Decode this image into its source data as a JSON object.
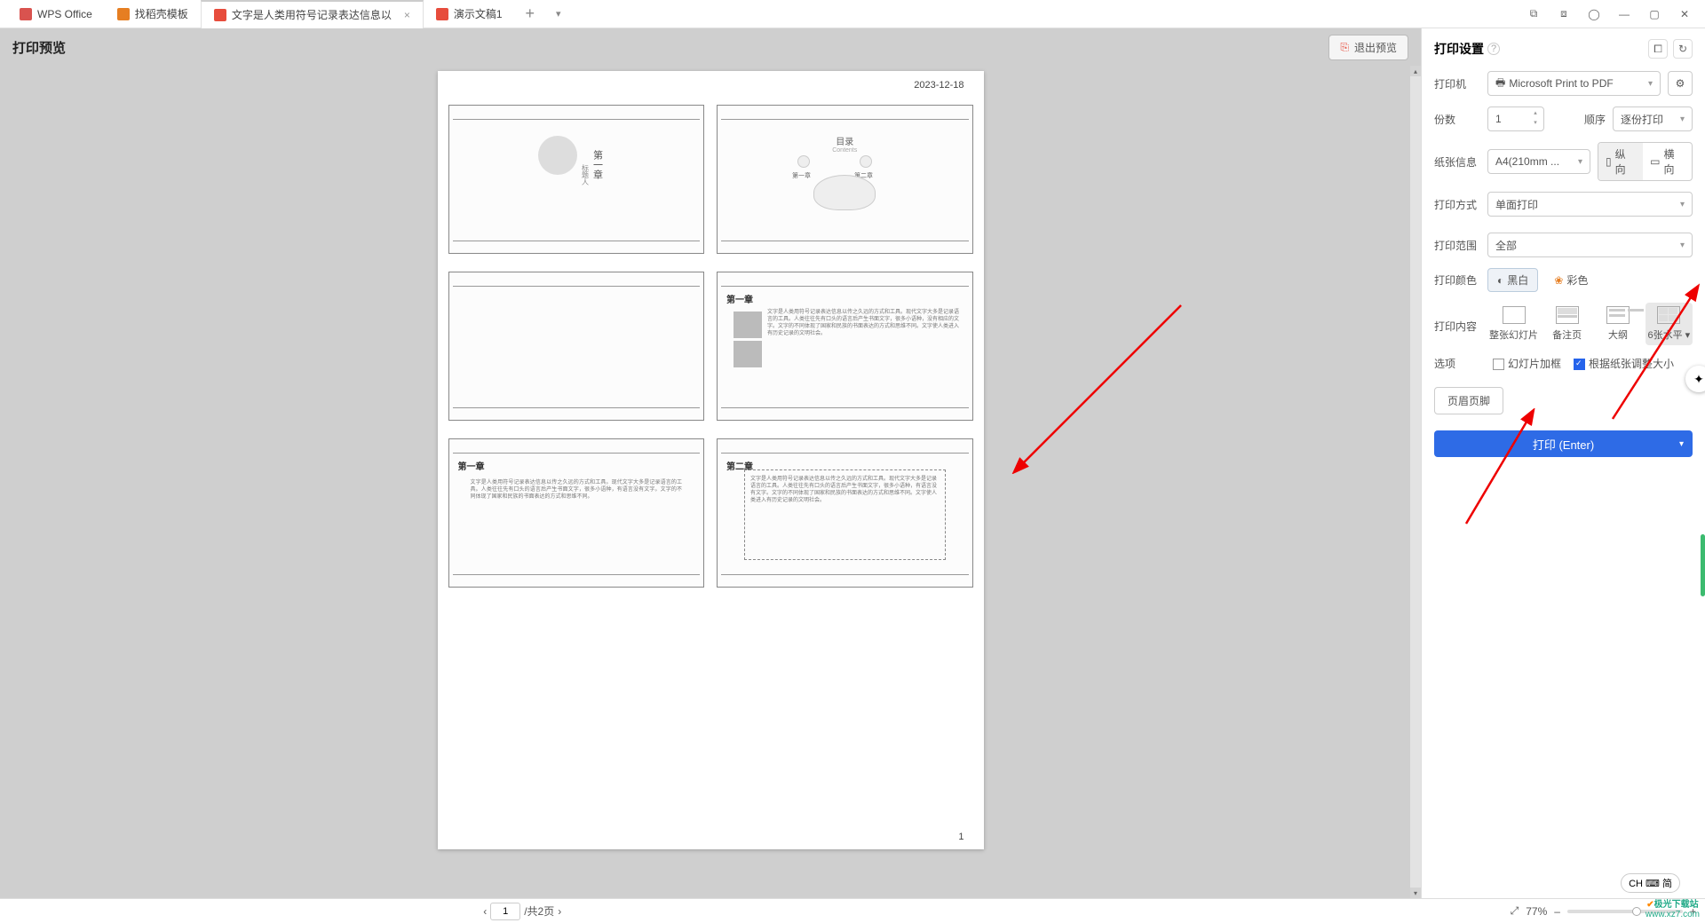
{
  "tabs": {
    "wps": "WPS Office",
    "tpl": "找稻壳模板",
    "doc": "文字是人类用符号记录表达信息以",
    "ppt": "演示文稿1"
  },
  "preview": {
    "title": "打印预览",
    "exit": "退出预览",
    "date": "2023-12-18",
    "page_num": "1",
    "slide_toc": "目录",
    "slide_toc_sub": "Contents",
    "chapter1": "第一章",
    "chapter2": "第二章",
    "tab1": "第一章",
    "tab2": "第二章",
    "title_main": "第一章",
    "title_sub": "标题人"
  },
  "settings": {
    "title": "打印设置",
    "printer_lbl": "打印机",
    "printer_val": "Microsoft Print to PDF",
    "copies_lbl": "份数",
    "copies_val": "1",
    "order_lbl": "顺序",
    "order_val": "逐份打印",
    "paper_lbl": "纸张信息",
    "paper_val": "A4(210mm ...",
    "orient_portrait": "纵向",
    "orient_landscape": "横向",
    "method_lbl": "打印方式",
    "method_val": "单面打印",
    "range_lbl": "打印范围",
    "range_val": "全部",
    "color_lbl": "打印颜色",
    "color_bw": "黑白",
    "color_c": "彩色",
    "content_lbl": "打印内容",
    "content_opts": [
      "整张幻灯片",
      "备注页",
      "大纲",
      "6张水平"
    ],
    "options_lbl": "选项",
    "opt_frame": "幻灯片加框",
    "opt_fit": "根据纸张调整大小",
    "header_footer": "页眉页脚",
    "print_btn": "打印 (Enter)"
  },
  "status": {
    "page_current": "1",
    "page_total": "/共2页",
    "zoom": "77%",
    "ime": "CH ⌨ 简"
  },
  "watermark": {
    "l1": "极光下载站",
    "l2": "www.xz7.com"
  }
}
